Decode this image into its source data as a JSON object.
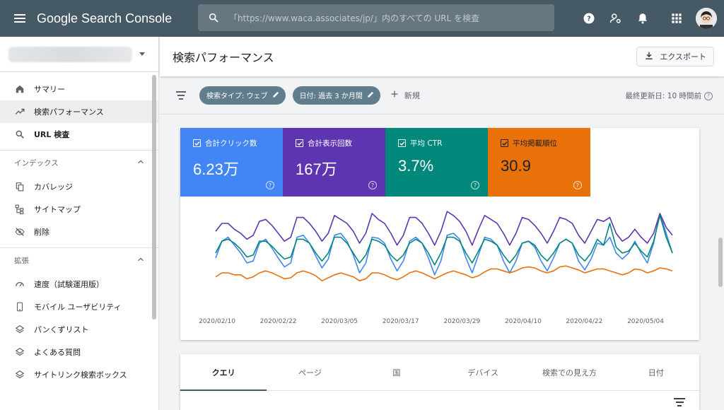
{
  "header": {
    "app_title": "Google Search Console",
    "search_placeholder": "「https://www.waca.associates/jp/」内のすべての URL を検査"
  },
  "sidebar": {
    "items_top": [
      {
        "label": "サマリー",
        "icon": "home-icon"
      },
      {
        "label": "検索パフォーマンス",
        "icon": "trending-up-icon",
        "active": true
      },
      {
        "label": "URL 検査",
        "icon": "search-icon"
      }
    ],
    "group_index": {
      "label": "インデックス",
      "items": [
        {
          "label": "カバレッジ",
          "icon": "copy-icon"
        },
        {
          "label": "サイトマップ",
          "icon": "sitemap-icon"
        },
        {
          "label": "削除",
          "icon": "eye-off-icon"
        }
      ]
    },
    "group_enhance": {
      "label": "拡張",
      "items": [
        {
          "label": "速度（試験運用版）",
          "icon": "speed-icon"
        },
        {
          "label": "モバイル ユーザビリティ",
          "icon": "phone-icon"
        },
        {
          "label": "パンくずリスト",
          "icon": "layers-icon"
        },
        {
          "label": "よくある質問",
          "icon": "layers-icon"
        },
        {
          "label": "サイトリンク検索ボックス",
          "icon": "layers-icon"
        }
      ]
    }
  },
  "main": {
    "title": "検索パフォーマンス",
    "export_label": "エクスポート",
    "filters": {
      "search_type": "検索タイプ: ウェブ",
      "date": "日付: 過去 3 か月間",
      "new_label": "新規",
      "last_updated": "最終更新日: 10 時間前"
    },
    "metrics": [
      {
        "label": "合計クリック数",
        "value": "6.23万",
        "color": "#4285f4"
      },
      {
        "label": "合計表示回数",
        "value": "167万",
        "color": "#5e35b1"
      },
      {
        "label": "平均 CTR",
        "value": "3.7%",
        "color": "#00897b"
      },
      {
        "label": "平均掲載順位",
        "value": "30.9",
        "color": "#e8710a"
      }
    ],
    "tabs": [
      "クエリ",
      "ページ",
      "国",
      "デバイス",
      "検索での見え方",
      "日付"
    ]
  },
  "chart_data": {
    "type": "line",
    "x_tick_labels": [
      "2020/02/10",
      "2020/02/22",
      "2020/03/05",
      "2020/03/17",
      "2020/03/29",
      "2020/04/10",
      "2020/04/22",
      "2020/05/04"
    ],
    "series": [
      {
        "name": "合計クリック数",
        "color": "#4285f4",
        "values": [
          0.45,
          0.62,
          0.66,
          0.58,
          0.5,
          0.4,
          0.42,
          0.6,
          0.64,
          0.55,
          0.45,
          0.36,
          0.4,
          0.66,
          0.68,
          0.6,
          0.47,
          0.35,
          0.44,
          0.68,
          0.7,
          0.62,
          0.48,
          0.3,
          0.4,
          0.66,
          0.65,
          0.6,
          0.44,
          0.32,
          0.42,
          0.62,
          0.66,
          0.6,
          0.45,
          0.28,
          0.42,
          0.68,
          0.7,
          0.64,
          0.45,
          0.3,
          0.48,
          0.66,
          0.64,
          0.58,
          0.42,
          0.3,
          0.42,
          0.6,
          0.62,
          0.56,
          0.42,
          0.32,
          0.45,
          0.6,
          0.64,
          0.6,
          0.42,
          0.33,
          0.44,
          0.6,
          0.58,
          0.66,
          0.5,
          0.44,
          0.5,
          0.62,
          0.5,
          0.4,
          0.6,
          0.9,
          0.7,
          0.5
        ]
      },
      {
        "name": "合計表示回数",
        "color": "#5e35b1",
        "values": [
          0.72,
          0.8,
          0.8,
          0.74,
          0.7,
          0.64,
          0.68,
          0.82,
          0.84,
          0.78,
          0.7,
          0.62,
          0.66,
          0.86,
          0.86,
          0.8,
          0.72,
          0.62,
          0.7,
          0.88,
          0.84,
          0.8,
          0.72,
          0.6,
          0.7,
          0.9,
          0.84,
          0.8,
          0.7,
          0.58,
          0.68,
          0.86,
          0.86,
          0.8,
          0.7,
          0.58,
          0.72,
          0.92,
          0.88,
          0.82,
          0.72,
          0.58,
          0.74,
          0.88,
          0.84,
          0.8,
          0.7,
          0.58,
          0.7,
          0.86,
          0.84,
          0.78,
          0.7,
          0.6,
          0.72,
          0.86,
          0.84,
          0.8,
          0.68,
          0.6,
          0.72,
          0.84,
          0.82,
          0.86,
          0.7,
          0.62,
          0.66,
          0.74,
          0.66,
          0.6,
          0.7,
          0.9,
          0.76,
          0.68
        ]
      },
      {
        "name": "平均 CTR",
        "color": "#00897b",
        "values": [
          0.5,
          0.62,
          0.64,
          0.6,
          0.54,
          0.46,
          0.48,
          0.62,
          0.62,
          0.57,
          0.5,
          0.44,
          0.46,
          0.64,
          0.64,
          0.6,
          0.5,
          0.42,
          0.5,
          0.66,
          0.66,
          0.6,
          0.5,
          0.4,
          0.48,
          0.64,
          0.62,
          0.58,
          0.48,
          0.42,
          0.48,
          0.6,
          0.64,
          0.6,
          0.5,
          0.38,
          0.5,
          0.66,
          0.66,
          0.62,
          0.5,
          0.4,
          0.52,
          0.64,
          0.62,
          0.58,
          0.48,
          0.4,
          0.48,
          0.6,
          0.62,
          0.58,
          0.48,
          0.42,
          0.5,
          0.6,
          0.64,
          0.6,
          0.48,
          0.42,
          0.5,
          0.64,
          0.58,
          0.8,
          0.56,
          0.5,
          0.52,
          0.6,
          0.52,
          0.46,
          0.62,
          0.88,
          0.66,
          0.5
        ]
      },
      {
        "name": "平均掲載順位",
        "color": "#e8710a",
        "values": [
          0.26,
          0.3,
          0.3,
          0.28,
          0.28,
          0.24,
          0.26,
          0.3,
          0.32,
          0.3,
          0.27,
          0.24,
          0.25,
          0.3,
          0.32,
          0.3,
          0.27,
          0.22,
          0.25,
          0.28,
          0.3,
          0.28,
          0.26,
          0.22,
          0.24,
          0.3,
          0.3,
          0.28,
          0.25,
          0.23,
          0.26,
          0.3,
          0.32,
          0.3,
          0.27,
          0.24,
          0.27,
          0.3,
          0.32,
          0.3,
          0.28,
          0.25,
          0.27,
          0.31,
          0.34,
          0.34,
          0.32,
          0.3,
          0.32,
          0.35,
          0.36,
          0.35,
          0.32,
          0.3,
          0.32,
          0.36,
          0.37,
          0.35,
          0.33,
          0.3,
          0.32,
          0.34,
          0.34,
          0.32,
          0.3,
          0.28,
          0.3,
          0.34,
          0.33,
          0.3,
          0.32,
          0.35,
          0.34,
          0.32
        ]
      }
    ]
  }
}
